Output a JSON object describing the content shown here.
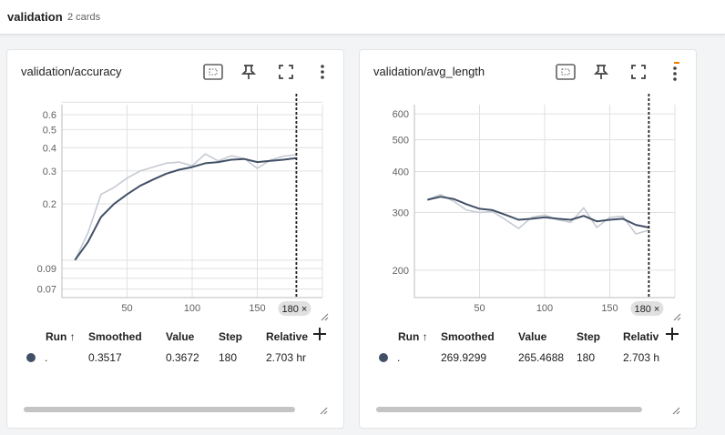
{
  "header": {
    "title": "validation",
    "count": "2 cards"
  },
  "colors": {
    "smoothed": "#425066",
    "raw": "#c5cad3",
    "grid": "#e0e0e0"
  },
  "icons": [
    "fit-domain-icon",
    "pin-icon",
    "fullscreen-icon",
    "more-vert-icon",
    "plus-icon",
    "resize-handle-icon",
    "sort-arrow-icon"
  ],
  "cards": [
    {
      "title": "validation/accuracy",
      "step_chip": "180 ×",
      "table": {
        "headers": [
          "Run ↑",
          "Smoothed",
          "Value",
          "Step",
          "Relative"
        ],
        "row": {
          "run": ".",
          "smoothed": "0.3517",
          "value": "0.3672",
          "step": "180",
          "relative": "2.703 hr"
        }
      },
      "chart_data": {
        "type": "line",
        "y_scale": "log",
        "xlim": [
          0,
          200
        ],
        "ylim": [
          0.063,
          0.68
        ],
        "x_ticks": [
          50,
          100,
          150
        ],
        "x_tick_labels": [
          "50",
          "100",
          "150"
        ],
        "y_ticks": [
          0.07,
          0.09,
          0.2,
          0.3,
          0.4,
          0.5,
          0.6
        ],
        "y_tick_labels": [
          "0.07",
          "0.09",
          "0.2",
          "0.3",
          "0.4",
          "0.5",
          "0.6"
        ],
        "y_minor_grid": [
          0.08,
          0.1,
          0.7
        ],
        "grid": true,
        "cursor_step": 180,
        "series": [
          {
            "x": [
              10,
              20,
              30,
              40,
              50,
              60,
              70,
              80,
              90,
              100,
              110,
              120,
              130,
              140,
              150,
              160,
              170,
              180
            ],
            "values": [
              0.1,
              0.14,
              0.225,
              0.245,
              0.275,
              0.3,
              0.315,
              0.33,
              0.335,
              0.32,
              0.37,
              0.34,
              0.362,
              0.35,
              0.31,
              0.343,
              0.36,
              0.367
            ]
          },
          {
            "x": [
              10,
              20,
              30,
              40,
              50,
              60,
              70,
              80,
              90,
              100,
              110,
              120,
              130,
              140,
              150,
              160,
              170,
              180
            ],
            "values": [
              0.1,
              0.125,
              0.17,
              0.2,
              0.225,
              0.25,
              0.27,
              0.29,
              0.305,
              0.315,
              0.33,
              0.335,
              0.345,
              0.348,
              0.335,
              0.34,
              0.345,
              0.352
            ]
          }
        ]
      }
    },
    {
      "title": "validation/avg_length",
      "step_chip": "180 ×",
      "table": {
        "headers": [
          "Run ↑",
          "Smoothed",
          "Value",
          "Step",
          "Relativ"
        ],
        "row": {
          "run": ".",
          "smoothed": "269.9299",
          "value": "265.4688",
          "step": "180",
          "relative": "2.703 h"
        }
      },
      "chart_data": {
        "type": "line",
        "y_scale": "log",
        "xlim": [
          0,
          200
        ],
        "ylim": [
          165,
          640
        ],
        "x_ticks": [
          50,
          100,
          150
        ],
        "x_tick_labels": [
          "50",
          "100",
          "150"
        ],
        "y_ticks": [
          200,
          300,
          400,
          500,
          600
        ],
        "y_tick_labels": [
          "200",
          "300",
          "400",
          "500",
          "600"
        ],
        "grid": true,
        "cursor_step": 180,
        "series": [
          {
            "x": [
              10,
              20,
              30,
              40,
              50,
              60,
              70,
              80,
              90,
              100,
              110,
              120,
              130,
              140,
              150,
              160,
              170,
              180
            ],
            "values": [
              328,
              340,
              325,
              305,
              300,
              302,
              285,
              268,
              290,
              295,
              285,
              280,
              310,
              270,
              290,
              292,
              258,
              265
            ]
          },
          {
            "x": [
              10,
              20,
              30,
              40,
              50,
              60,
              70,
              80,
              90,
              100,
              110,
              120,
              130,
              140,
              150,
              160,
              170,
              180
            ],
            "values": [
              328,
              335,
              330,
              318,
              308,
              305,
              295,
              285,
              287,
              290,
              287,
              285,
              293,
              282,
              285,
              287,
              275,
              270
            ]
          }
        ]
      }
    }
  ]
}
